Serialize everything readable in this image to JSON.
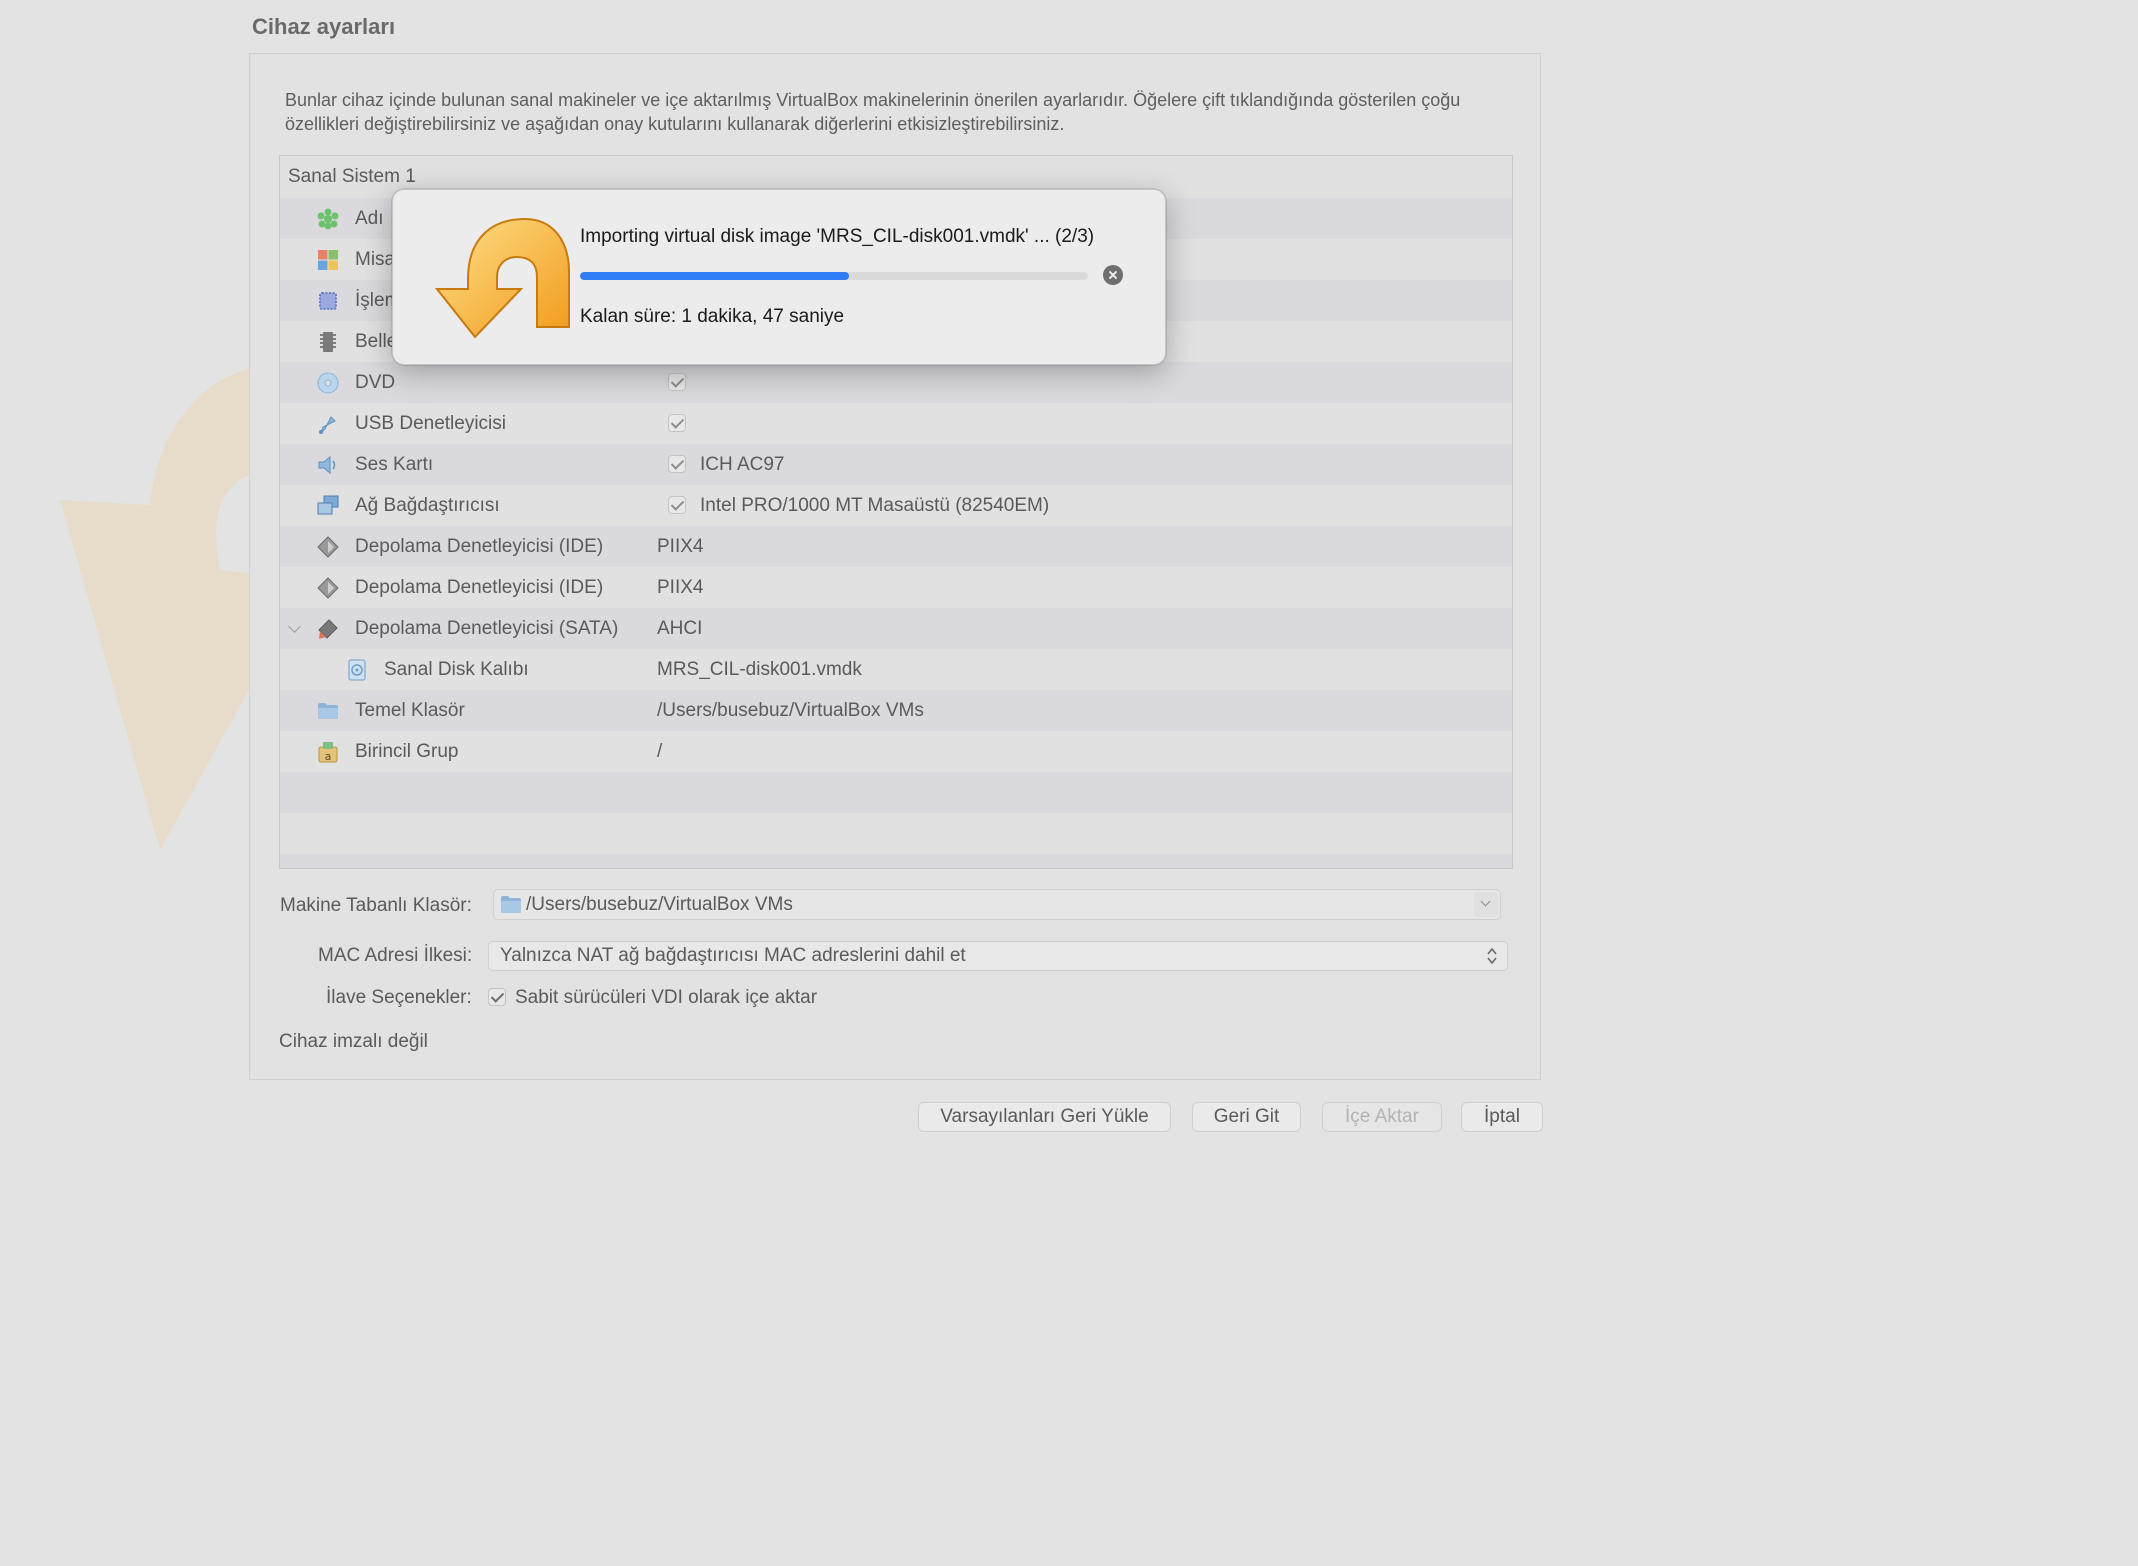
{
  "section_title": "Cihaz ayarları",
  "description": "Bunlar cihaz içinde bulunan sanal makineler ve içe aktarılmış VirtualBox makinelerinin önerilen ayarlarıdır. Öğelere çift tıklandığında gösterilen çoğu özellikleri değiştirebilirsiniz ve aşağıdan onay kutularını kullanarak diğerlerini etkisizleştirebilirsiniz.",
  "tree": {
    "header": "Sanal Sistem 1",
    "rows": [
      {
        "label": "Adı",
        "value": "",
        "icon": "name-icon"
      },
      {
        "label": "Misafir İşletim Sistemi Türü",
        "value": "",
        "icon": "os-type-icon"
      },
      {
        "label": "İşlemci",
        "value": "",
        "icon": "cpu-icon"
      },
      {
        "label": "Bellek",
        "value": "",
        "icon": "memory-icon"
      },
      {
        "label": "DVD",
        "value": "",
        "icon": "dvd-icon",
        "checked": true
      },
      {
        "label": "USB Denetleyicisi",
        "value": "",
        "icon": "usb-icon",
        "checked": true
      },
      {
        "label": "Ses Kartı",
        "value": "ICH AC97",
        "icon": "sound-icon",
        "checked": true
      },
      {
        "label": "Ağ Bağdaştırıcısı",
        "value": "Intel PRO/1000 MT Masaüstü (82540EM)",
        "icon": "network-icon",
        "checked": true
      },
      {
        "label": "Depolama Denetleyicisi (IDE)",
        "value": "PIIX4",
        "icon": "storage-ide-icon"
      },
      {
        "label": "Depolama Denetleyicisi (IDE)",
        "value": "PIIX4",
        "icon": "storage-ide-icon"
      },
      {
        "label": "Depolama Denetleyicisi (SATA)",
        "value": "AHCI",
        "icon": "storage-sata-icon",
        "expanded": true
      },
      {
        "label": "Sanal Disk Kalıbı",
        "value": "MRS_CIL-disk001.vmdk",
        "icon": "disk-image-icon",
        "child": true
      },
      {
        "label": "Temel Klasör",
        "value": "/Users/busebuz/VirtualBox VMs",
        "icon": "folder-icon"
      },
      {
        "label": "Birincil Grup",
        "value": "/",
        "icon": "group-icon"
      }
    ]
  },
  "machine_folder": {
    "label": "Makine Tabanlı Klasör:",
    "value": "/Users/busebuz/VirtualBox VMs"
  },
  "mac_policy": {
    "label": "MAC Adresi İlkesi:",
    "value": "Yalnızca NAT ağ bağdaştırıcısı MAC adreslerini dahil et"
  },
  "extra_options": {
    "label": "İlave Seçenekler:",
    "checkbox_label": "Sabit sürücüleri VDI olarak içe aktar",
    "checked": true
  },
  "signature_status": "Cihaz imzalı değil",
  "buttons": {
    "restore_defaults": "Varsayılanları Geri Yükle",
    "back": "Geri Git",
    "import": "İçe Aktar",
    "cancel": "İptal"
  },
  "progress_dialog": {
    "title": "Importing virtual disk image 'MRS_CIL-disk001.vmdk' ... (2/3)",
    "progress_fraction": 0.53,
    "remaining": "Kalan süre: 1 dakika, 47 saniye"
  },
  "colors": {
    "progress": "#2e7cf6",
    "arrow_orange": "#f5a623"
  }
}
